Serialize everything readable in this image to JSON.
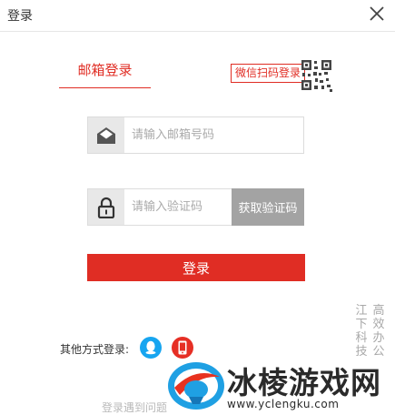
{
  "header": {
    "title": "登录"
  },
  "tabs": {
    "email": "邮箱登录"
  },
  "wechat": {
    "link_label": "微信扫码登录"
  },
  "email_input": {
    "placeholder": "请输入邮箱号码",
    "value": ""
  },
  "code_input": {
    "placeholder": "请输入验证码",
    "value": ""
  },
  "get_code_label": "获取验证码",
  "login_label": "登录",
  "other_methods_label": "其他方式登录:",
  "problem_label": "登录遇到问题",
  "watermark": {
    "col_a": "江下科技",
    "col_b": "高效办公",
    "brand": "冰棱游戏网",
    "url": "www.yclengku.com"
  },
  "icons": {
    "close": "close-icon",
    "qr": "qr-code-icon",
    "email": "envelope-icon",
    "lock": "lock-icon",
    "qq": "qq-icon",
    "phone": "phone-icon"
  },
  "colors": {
    "accent": "#e02d24",
    "qq": "#17a5f0",
    "get_code_bg": "#a3a3a3"
  }
}
